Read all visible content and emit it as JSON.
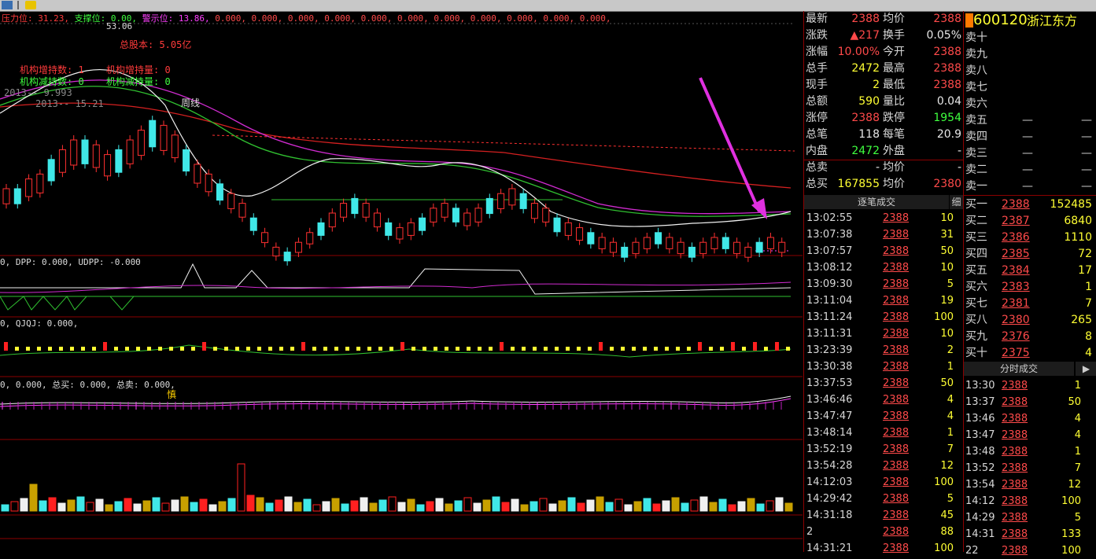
{
  "stock": {
    "code": "600120",
    "name": "浙江东方"
  },
  "top_indicator": {
    "pressure_label": "压力位: 31.23,",
    "support_label": "支撑位: 0.00,",
    "warn_label": "警示位: 13.86,",
    "rest": "0.000, 0.000, 0.000, 0.000, 0.000, 0.000, 0.000, 0.000, 0.000, 0.000, 0.000,"
  },
  "chart_text": {
    "high_mark": "53.06",
    "total_equity": "总股本: 5.05亿",
    "inst_inc": "机构增持数: 1",
    "inst_inc2": "机构增持量: 0",
    "inst_dec": "机构减持数: 0",
    "inst_dec2": "机构减持量: 0",
    "year1": "2013-- 9.993",
    "year2": "2013-- 15.21",
    "cycle": "周线",
    "ind1": "0, DPP: 0.000, UDPP: -0.000",
    "ind2": "0, QJQJ: 0.000,",
    "ind3": "0, 0.000, 总买: 0.000, 总卖: 0.000,",
    "caution": "慎"
  },
  "quote": {
    "rows": [
      {
        "l1": "最新",
        "v1": "2388",
        "l2": "均价",
        "v2": "2388",
        "c1": "red",
        "c2": "red"
      },
      {
        "l1": "涨跌",
        "v1": "▲217",
        "l2": "换手",
        "v2": "0.05%",
        "c1": "red",
        "c2": "wht"
      },
      {
        "l1": "涨幅",
        "v1": "10.00%",
        "l2": "今开",
        "v2": "2388",
        "c1": "red",
        "c2": "red"
      },
      {
        "l1": "总手",
        "v1": "2472",
        "l2": "最高",
        "v2": "2388",
        "c1": "yel",
        "c2": "red"
      },
      {
        "l1": "现手",
        "v1": "2",
        "l2": "最低",
        "v2": "2388",
        "c1": "yel",
        "c2": "red"
      },
      {
        "l1": "总额",
        "v1": "590",
        "l2": "量比",
        "v2": "0.04",
        "c1": "yel",
        "c2": "wht"
      },
      {
        "l1": "涨停",
        "v1": "2388",
        "l2": "跌停",
        "v2": "1954",
        "c1": "red",
        "c2": "grn"
      },
      {
        "l1": "总笔",
        "v1": "118",
        "l2": "每笔",
        "v2": "20.9",
        "c1": "wht",
        "c2": "wht"
      },
      {
        "l1": "内盘",
        "v1": "2472",
        "l2": "外盘",
        "v2": "-",
        "c1": "grn",
        "c2": "wht"
      },
      {
        "l1": "总卖",
        "v1": "-",
        "l2": "均价",
        "v2": "-",
        "c1": "wht",
        "c2": "wht"
      },
      {
        "l1": "总买",
        "v1": "167855",
        "l2": "均价",
        "v2": "2380",
        "c1": "yel",
        "c2": "red"
      }
    ],
    "trades_header": "逐笔成交",
    "trades_detail": "细",
    "trades": [
      {
        "t": "13:02:55",
        "p": "2388",
        "v": "10"
      },
      {
        "t": "13:07:38",
        "p": "2388",
        "v": "31"
      },
      {
        "t": "13:07:57",
        "p": "2388",
        "v": "50"
      },
      {
        "t": "13:08:12",
        "p": "2388",
        "v": "10"
      },
      {
        "t": "13:09:30",
        "p": "2388",
        "v": "5"
      },
      {
        "t": "13:11:04",
        "p": "2388",
        "v": "19"
      },
      {
        "t": "13:11:24",
        "p": "2388",
        "v": "100"
      },
      {
        "t": "13:11:31",
        "p": "2388",
        "v": "10"
      },
      {
        "t": "13:23:39",
        "p": "2388",
        "v": "2"
      },
      {
        "t": "13:30:38",
        "p": "2388",
        "v": "1"
      },
      {
        "t": "13:37:53",
        "p": "2388",
        "v": "50"
      },
      {
        "t": "13:46:46",
        "p": "2388",
        "v": "4"
      },
      {
        "t": "13:47:47",
        "p": "2388",
        "v": "4"
      },
      {
        "t": "13:48:14",
        "p": "2388",
        "v": "1"
      },
      {
        "t": "13:52:19",
        "p": "2388",
        "v": "7"
      },
      {
        "t": "13:54:28",
        "p": "2388",
        "v": "12"
      },
      {
        "t": "14:12:03",
        "p": "2388",
        "v": "100"
      },
      {
        "t": "14:29:42",
        "p": "2388",
        "v": "5"
      },
      {
        "t": "14:31:18",
        "p": "2388",
        "v": "45"
      },
      {
        "t": "2",
        "p": "2388",
        "v": "88"
      },
      {
        "t": "14:31:21",
        "p": "2388",
        "v": "100"
      }
    ]
  },
  "book": {
    "sells": [
      {
        "l": "卖十",
        "p": "",
        "v": ""
      },
      {
        "l": "卖九",
        "p": "",
        "v": ""
      },
      {
        "l": "卖八",
        "p": "",
        "v": ""
      },
      {
        "l": "卖七",
        "p": "",
        "v": ""
      },
      {
        "l": "卖六",
        "p": "",
        "v": ""
      },
      {
        "l": "卖五",
        "p": "—",
        "v": "—"
      },
      {
        "l": "卖四",
        "p": "—",
        "v": "—"
      },
      {
        "l": "卖三",
        "p": "—",
        "v": "—"
      },
      {
        "l": "卖二",
        "p": "—",
        "v": "—"
      },
      {
        "l": "卖一",
        "p": "—",
        "v": "—"
      }
    ],
    "buys": [
      {
        "l": "买一",
        "p": "2388",
        "v": "152485"
      },
      {
        "l": "买二",
        "p": "2387",
        "v": "6840"
      },
      {
        "l": "买三",
        "p": "2386",
        "v": "1110"
      },
      {
        "l": "买四",
        "p": "2385",
        "v": "72"
      },
      {
        "l": "买五",
        "p": "2384",
        "v": "17"
      },
      {
        "l": "买六",
        "p": "2383",
        "v": "1"
      },
      {
        "l": "买七",
        "p": "2381",
        "v": "7"
      },
      {
        "l": "买八",
        "p": "2380",
        "v": "265"
      },
      {
        "l": "买九",
        "p": "2376",
        "v": "8"
      },
      {
        "l": "买十",
        "p": "2375",
        "v": "4"
      }
    ],
    "minute_header": "分时成交",
    "minute": [
      {
        "t": "13:30",
        "p": "2388",
        "v": "1"
      },
      {
        "t": "13:37",
        "p": "2388",
        "v": "50"
      },
      {
        "t": "13:46",
        "p": "2388",
        "v": "4"
      },
      {
        "t": "13:47",
        "p": "2388",
        "v": "4"
      },
      {
        "t": "13:48",
        "p": "2388",
        "v": "1"
      },
      {
        "t": "13:52",
        "p": "2388",
        "v": "7"
      },
      {
        "t": "13:54",
        "p": "2388",
        "v": "12"
      },
      {
        "t": "14:12",
        "p": "2388",
        "v": "100"
      },
      {
        "t": "14:29",
        "p": "2388",
        "v": "5"
      },
      {
        "t": "14:31",
        "p": "2388",
        "v": "133"
      },
      {
        "t": "22",
        "p": "2388",
        "v": "100"
      }
    ]
  },
  "candles": [
    [
      30,
      2,
      12
    ],
    [
      30,
      2,
      12
    ],
    [
      28,
      3,
      14
    ],
    [
      27,
      3,
      15
    ],
    [
      24,
      3,
      17
    ],
    [
      22,
      3,
      18
    ],
    [
      20,
      4,
      20
    ],
    [
      20,
      3,
      19
    ],
    [
      21,
      3,
      18
    ],
    [
      23,
      3,
      17
    ],
    [
      22,
      3,
      18
    ],
    [
      20,
      3,
      19
    ],
    [
      18,
      3,
      20
    ],
    [
      16,
      3,
      21
    ],
    [
      17,
      3,
      20
    ],
    [
      19,
      3,
      18
    ],
    [
      22,
      3,
      17
    ],
    [
      25,
      3,
      15
    ],
    [
      27,
      3,
      14
    ],
    [
      29,
      3,
      13
    ],
    [
      31,
      3,
      12
    ],
    [
      33,
      3,
      11
    ],
    [
      36,
      3,
      10
    ],
    [
      39,
      3,
      8
    ],
    [
      42,
      3,
      7
    ],
    [
      43,
      3,
      7
    ],
    [
      41,
      3,
      8
    ],
    [
      39,
      3,
      9
    ],
    [
      37,
      3,
      10
    ],
    [
      35,
      3,
      11
    ],
    [
      33,
      3,
      11
    ],
    [
      32,
      3,
      12
    ],
    [
      33,
      3,
      11
    ],
    [
      35,
      3,
      11
    ],
    [
      37,
      3,
      10
    ],
    [
      38,
      3,
      9
    ],
    [
      37,
      3,
      10
    ],
    [
      36,
      3,
      10
    ],
    [
      34,
      3,
      11
    ],
    [
      33,
      3,
      11
    ],
    [
      34,
      3,
      11
    ],
    [
      35,
      3,
      10
    ],
    [
      34,
      3,
      11
    ],
    [
      32,
      3,
      12
    ],
    [
      31,
      3,
      12
    ],
    [
      30,
      3,
      13
    ],
    [
      31,
      3,
      12
    ],
    [
      33,
      3,
      12
    ],
    [
      34,
      3,
      11
    ],
    [
      36,
      3,
      11
    ],
    [
      37,
      3,
      10
    ],
    [
      38,
      3,
      10
    ],
    [
      39,
      3,
      9
    ],
    [
      40,
      3,
      9
    ],
    [
      41,
      3,
      8
    ],
    [
      42,
      3,
      8
    ],
    [
      41,
      3,
      9
    ],
    [
      40,
      3,
      9
    ],
    [
      39,
      3,
      9
    ],
    [
      40,
      3,
      9
    ],
    [
      41,
      3,
      9
    ],
    [
      42,
      3,
      8
    ],
    [
      41,
      3,
      9
    ],
    [
      40,
      3,
      9
    ],
    [
      40,
      3,
      9
    ],
    [
      41,
      3,
      9
    ],
    [
      42,
      3,
      8
    ],
    [
      41,
      3,
      8
    ],
    [
      40,
      3,
      9
    ],
    [
      41,
      3,
      8
    ]
  ]
}
